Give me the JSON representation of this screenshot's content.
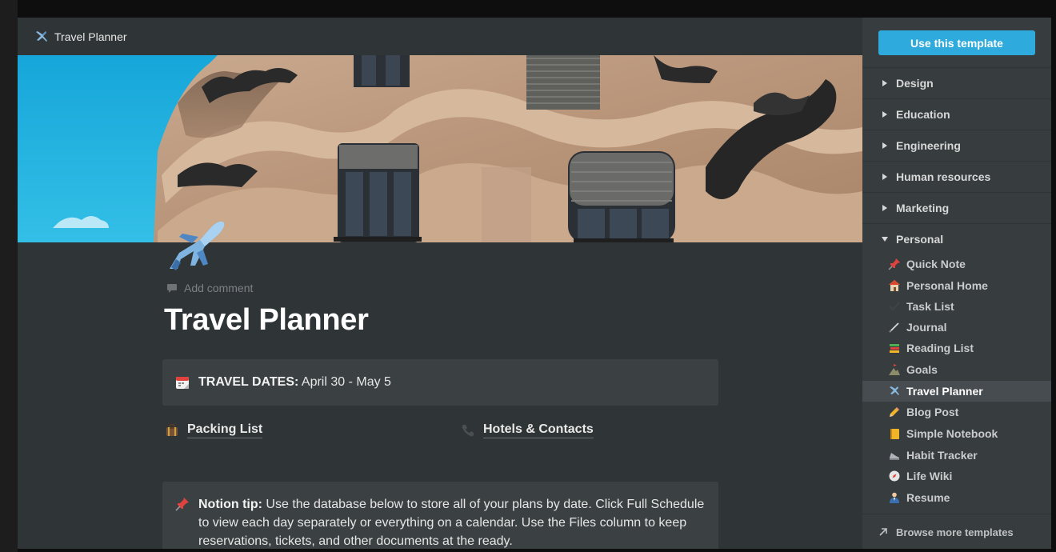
{
  "window": {
    "title": "Travel Planner"
  },
  "page": {
    "add_comment": "Add comment",
    "title": "Travel Planner",
    "travel_dates_label": "TRAVEL DATES:",
    "travel_dates_value": " April 30 - May 5",
    "links": [
      {
        "label": "Packing List",
        "icon": "luggage-icon"
      },
      {
        "label": "Hotels & Contacts",
        "icon": "phone-icon"
      }
    ],
    "tip": {
      "label": "Notion tip:",
      "text": " Use the database below to store all of your plans by date. Click Full Schedule to view each day separately or everything on a calendar. Use the Files column to keep reservations, tickets, and other documents at the ready."
    }
  },
  "sidebar": {
    "use_button": "Use this template",
    "categories": [
      {
        "label": "Design",
        "expanded": false
      },
      {
        "label": "Education",
        "expanded": false
      },
      {
        "label": "Engineering",
        "expanded": false
      },
      {
        "label": "Human resources",
        "expanded": false
      },
      {
        "label": "Marketing",
        "expanded": false
      },
      {
        "label": "Personal",
        "expanded": true
      }
    ],
    "templates": [
      {
        "label": "Quick Note",
        "icon": "pushpin-icon"
      },
      {
        "label": "Personal Home",
        "icon": "house-icon"
      },
      {
        "label": "Task List",
        "icon": "checkmark-icon"
      },
      {
        "label": "Journal",
        "icon": "pen-icon"
      },
      {
        "label": "Reading List",
        "icon": "books-icon"
      },
      {
        "label": "Goals",
        "icon": "mountain-flag-icon"
      },
      {
        "label": "Travel Planner",
        "icon": "airplane-icon",
        "active": true
      },
      {
        "label": "Blog Post",
        "icon": "pencil-icon"
      },
      {
        "label": "Simple Notebook",
        "icon": "notebook-icon"
      },
      {
        "label": "Habit Tracker",
        "icon": "running-shoe-icon"
      },
      {
        "label": "Life Wiki",
        "icon": "compass-icon"
      },
      {
        "label": "Resume",
        "icon": "person-suit-icon"
      }
    ],
    "browse_more": "Browse more templates"
  },
  "colors": {
    "accent": "#2eaadc",
    "background": "#2f3437",
    "sidebar": "#373c3f",
    "callout": "#3b4043"
  }
}
